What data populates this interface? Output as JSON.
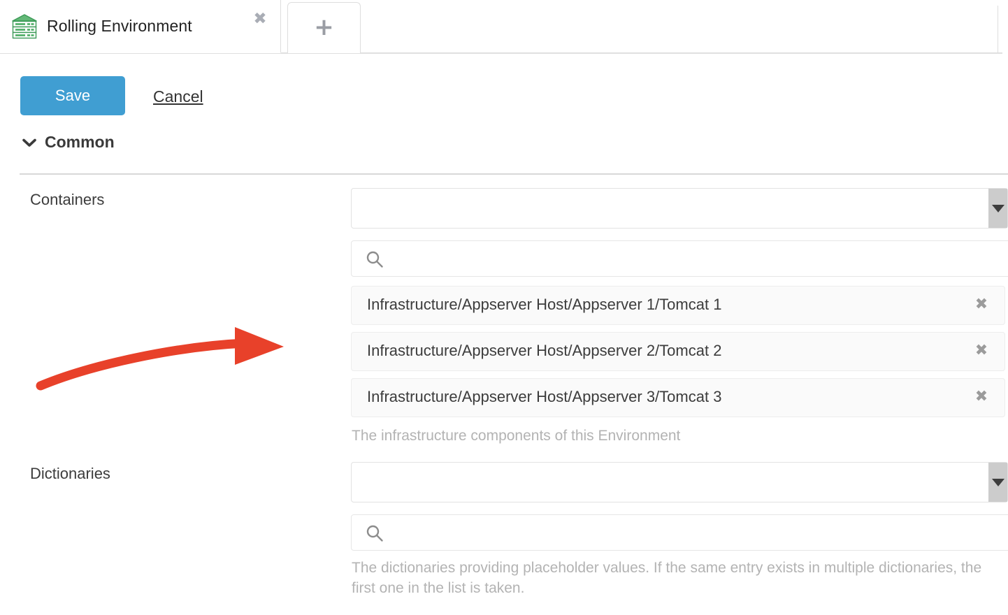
{
  "colors": {
    "accent_blue": "#409ed2",
    "tab_icon_green": "#4aab62",
    "annotation_red": "#e8412a",
    "dropdown_grey": "#cccccc",
    "help_text_grey": "#b3b3b3"
  },
  "tabbar": {
    "active_tab": {
      "title": "Rolling Environment",
      "icon": "server-stack-icon",
      "close_label": "✖"
    },
    "new_tab": {
      "label": "+",
      "icon": "plus-icon"
    }
  },
  "toolbar": {
    "save_label": "Save",
    "cancel_label": "Cancel"
  },
  "section": {
    "title": "Common",
    "chevron": "chevron-down-icon"
  },
  "fields": {
    "containers": {
      "label": "Containers",
      "select_value": "",
      "search_value": "",
      "search_placeholder": "",
      "items": [
        {
          "text": "Infrastructure/Appserver Host/Appserver 1/Tomcat 1",
          "remove_label": "✖"
        },
        {
          "text": "Infrastructure/Appserver Host/Appserver 2/Tomcat 2",
          "remove_label": "✖"
        },
        {
          "text": "Infrastructure/Appserver Host/Appserver 3/Tomcat 3",
          "remove_label": "✖"
        }
      ],
      "help": "The infrastructure components of this Environment"
    },
    "dictionaries": {
      "label": "Dictionaries",
      "select_value": "",
      "search_value": "",
      "search_placeholder": "",
      "items": [],
      "help": "The dictionaries providing placeholder values. If the same entry exists in multiple dictionaries, the first one in the list is taken."
    }
  },
  "annotation": {
    "shape": "curved-arrow-right",
    "color": "#e8412a"
  }
}
